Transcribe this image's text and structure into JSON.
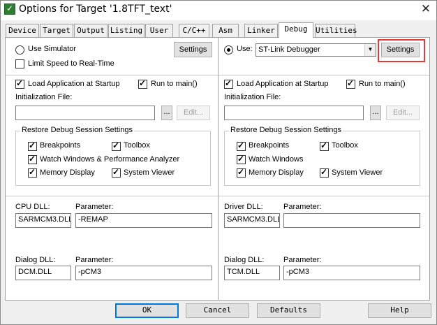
{
  "window": {
    "title": "Options for Target '1.8TFT_text'",
    "close": "✕"
  },
  "tabs": [
    "Device",
    "Target",
    "Output",
    "Listing",
    "User",
    "C/C++",
    "Asm",
    "Linker",
    "Debug",
    "Utilities"
  ],
  "active_tab": "Debug",
  "left": {
    "use_simulator": "Use Simulator",
    "settings": "Settings",
    "limit_speed": "Limit Speed to Real-Time",
    "load_app": "Load Application at Startup",
    "run_to_main": "Run to main()",
    "init_file_label": "Initialization File:",
    "init_file_value": "",
    "browse": "...",
    "edit": "Edit...",
    "restore_title": "Restore Debug Session Settings",
    "breakpoints": "Breakpoints",
    "toolbox": "Toolbox",
    "watch_windows": "Watch Windows & Performance Analyzer",
    "memory_display": "Memory Display",
    "system_viewer": "System Viewer",
    "cpu_dll_label": "CPU DLL:",
    "cpu_param_label": "Parameter:",
    "cpu_dll": "SARMCM3.DLL",
    "cpu_param": "-REMAP",
    "dialog_dll_label": "Dialog DLL:",
    "dialog_param_label": "Parameter:",
    "dialog_dll": "DCM.DLL",
    "dialog_param": "-pCM3"
  },
  "right": {
    "use": "Use:",
    "debugger": "ST-Link Debugger",
    "settings": "Settings",
    "load_app": "Load Application at Startup",
    "run_to_main": "Run to main()",
    "init_file_label": "Initialization File:",
    "init_file_value": "",
    "browse": "...",
    "edit": "Edit...",
    "restore_title": "Restore Debug Session Settings",
    "breakpoints": "Breakpoints",
    "toolbox": "Toolbox",
    "watch_windows": "Watch Windows",
    "memory_display": "Memory Display",
    "system_viewer": "System Viewer",
    "driver_dll_label": "Driver DLL:",
    "driver_param_label": "Parameter:",
    "driver_dll": "SARMCM3.DLL",
    "driver_param": "",
    "dialog_dll_label": "Dialog DLL:",
    "dialog_param_label": "Parameter:",
    "dialog_dll": "TCM.DLL",
    "dialog_param": "-pCM3"
  },
  "buttons": {
    "ok": "OK",
    "cancel": "Cancel",
    "defaults": "Defaults",
    "help": "Help"
  },
  "colors": {
    "highlight": "#e53935",
    "panel_bg": "#ffffff",
    "dialog_bg": "#f0f0f0"
  }
}
